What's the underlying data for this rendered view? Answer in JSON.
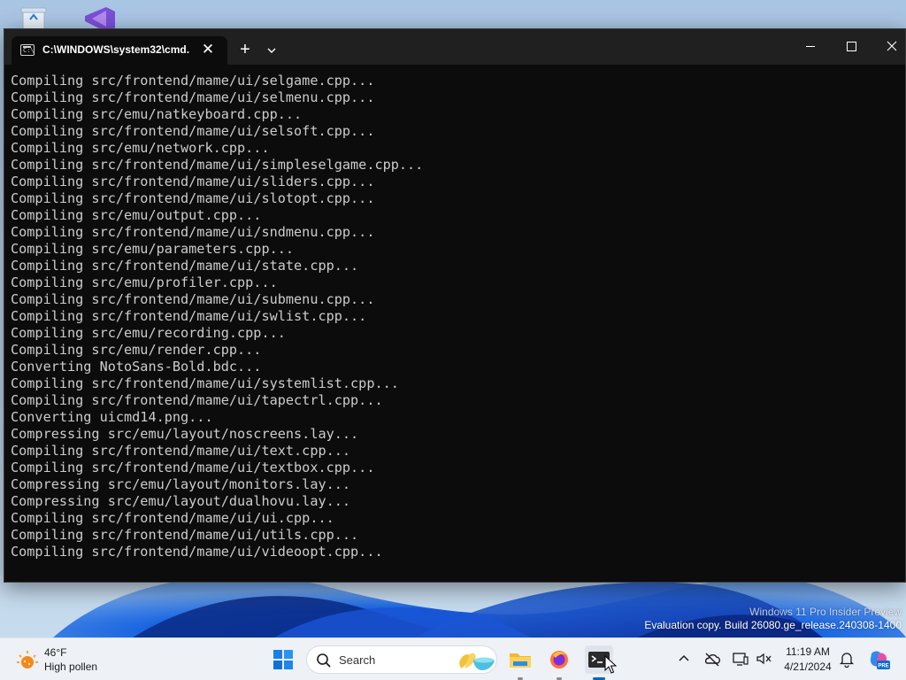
{
  "colors": {
    "terminal_background": "#0c0c0c",
    "terminal_text": "#cccccc",
    "titlebar": "#202020",
    "taskbar": "#eef1f6",
    "accent": "#0067c0"
  },
  "desktop": {
    "icons": [
      "recycle-bin-icon",
      "visual-studio-icon"
    ],
    "watermark": {
      "line1": "Windows 11 Pro Insider Preview",
      "line2": "Evaluation copy. Build 26080.ge_release.240308-1400"
    }
  },
  "terminal": {
    "tab_title": "C:\\WINDOWS\\system32\\cmd.",
    "tab_icon_glyph": "C:\\",
    "new_tab_glyph": "+",
    "close_glyph": "✕",
    "lines": [
      "Compiling src/frontend/mame/ui/selgame.cpp...",
      "Compiling src/frontend/mame/ui/selmenu.cpp...",
      "Compiling src/emu/natkeyboard.cpp...",
      "Compiling src/frontend/mame/ui/selsoft.cpp...",
      "Compiling src/emu/network.cpp...",
      "Compiling src/frontend/mame/ui/simpleselgame.cpp...",
      "Compiling src/frontend/mame/ui/sliders.cpp...",
      "Compiling src/frontend/mame/ui/slotopt.cpp...",
      "Compiling src/emu/output.cpp...",
      "Compiling src/frontend/mame/ui/sndmenu.cpp...",
      "Compiling src/emu/parameters.cpp...",
      "Compiling src/frontend/mame/ui/state.cpp...",
      "Compiling src/emu/profiler.cpp...",
      "Compiling src/frontend/mame/ui/submenu.cpp...",
      "Compiling src/frontend/mame/ui/swlist.cpp...",
      "Compiling src/emu/recording.cpp...",
      "Compiling src/emu/render.cpp...",
      "Converting NotoSans-Bold.bdc...",
      "Compiling src/frontend/mame/ui/systemlist.cpp...",
      "Compiling src/frontend/mame/ui/tapectrl.cpp...",
      "Converting uicmd14.png...",
      "Compressing src/emu/layout/noscreens.lay...",
      "Compiling src/frontend/mame/ui/text.cpp...",
      "Compiling src/frontend/mame/ui/textbox.cpp...",
      "Compressing src/emu/layout/monitors.lay...",
      "Compressing src/emu/layout/dualhovu.lay...",
      "Compiling src/frontend/mame/ui/ui.cpp...",
      "Compiling src/frontend/mame/ui/utils.cpp...",
      "Compiling src/frontend/mame/ui/videoopt.cpp..."
    ]
  },
  "taskbar": {
    "weather": {
      "temperature": "46°F",
      "description": "High pollen",
      "icon": "weather-pollen-icon"
    },
    "search_placeholder": "Search",
    "apps": [
      "start-button",
      "file-explorer",
      "firefox",
      "terminal"
    ],
    "active_app": "terminal",
    "tray_icons": [
      "chevron-up-icon",
      "onedrive-icon",
      "display-icon",
      "speaker-icon",
      "notification-bell-icon",
      "copilot-icon"
    ],
    "copilot_badge": "PRE",
    "clock": {
      "time": "11:19 AM",
      "date": "4/21/2024"
    }
  }
}
